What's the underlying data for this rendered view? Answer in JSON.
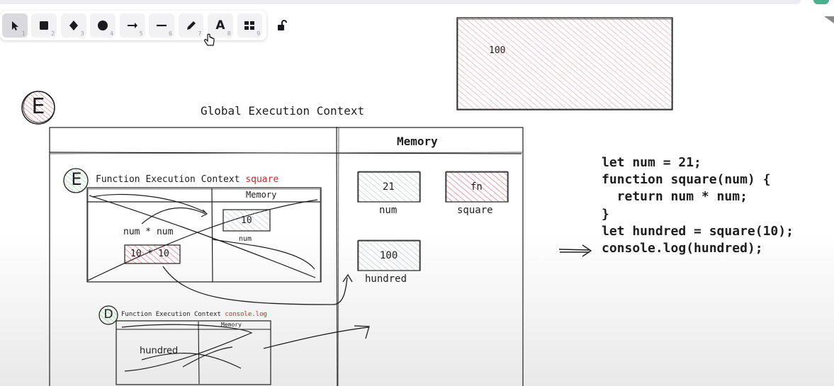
{
  "toolbar": {
    "tools": [
      {
        "name": "selection",
        "icon": "arrow-cursor-icon",
        "key": "1"
      },
      {
        "name": "rectangle",
        "icon": "square-icon",
        "key": "2"
      },
      {
        "name": "diamond",
        "icon": "diamond-icon",
        "key": "3"
      },
      {
        "name": "ellipse",
        "icon": "circle-icon",
        "key": "4"
      },
      {
        "name": "arrow",
        "icon": "arrow-right-icon",
        "key": "5"
      },
      {
        "name": "line",
        "icon": "line-icon",
        "key": "6"
      },
      {
        "name": "draw",
        "icon": "pencil-icon",
        "key": "7"
      },
      {
        "name": "text",
        "icon": "text-icon",
        "key": "8",
        "glyph": "A"
      },
      {
        "name": "library",
        "icon": "library-grid-icon",
        "key": "9"
      }
    ],
    "active_tool": "selection"
  },
  "canvas": {
    "top_box_value": "100",
    "gec_badge": "E",
    "gec_title": "Global Execution Context",
    "gec_memory_header": "Memory",
    "mem_num_value": "21",
    "mem_num_label": "num",
    "mem_square_value": "fn",
    "mem_square_label": "square",
    "mem_hundred_value": "100",
    "mem_hundred_label": "hundred",
    "fec1_badge": "E",
    "fec1_title": "Function Execution Context",
    "fec1_fn_name": "square",
    "fec1_memory_header": "Memory",
    "fec1_expr": "num * num",
    "fec1_result": "10 * 10",
    "fec1_mem_value": "10",
    "fec1_mem_label": "num",
    "fec2_badge": "D",
    "fec2_title": "Function Execution Context",
    "fec2_fn_name": "console.log",
    "fec2_memory_header": "Memory",
    "fec2_var": "hundred",
    "code_lines": [
      "let num = 21;",
      "function square(num) {",
      "  return num * num;",
      "}",
      "let hundred = square(10);",
      "console.log(hundred);"
    ],
    "current_line_arrow": "⟶"
  },
  "colors": {
    "hatch_red": "#e06c75",
    "red_text": "#c92a2a",
    "hatch_gray": "#adb5bd",
    "hatch_green": "#69db7c",
    "badge_red_fill": "#f3a6a6",
    "badge_green_fill": "#b2f2bb"
  }
}
